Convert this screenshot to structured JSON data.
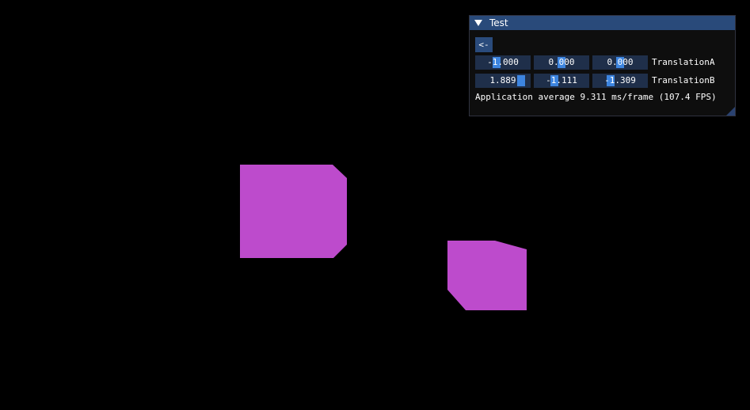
{
  "window": {
    "title": "Test",
    "collapse_icon": "triangle-down-icon",
    "back_label": "<-",
    "translation_a": {
      "label": "TranslationA",
      "values": [
        "-1.000",
        "0.000",
        "0.000"
      ]
    },
    "translation_b": {
      "label": "TranslationB",
      "values": [
        "1.889",
        "-1.111",
        "-1.309"
      ]
    },
    "status": "Application average 9.311 ms/frame (107.4 FPS)",
    "colors": {
      "title_bar": "#294a7a",
      "frame_bg": "#1f2f4a",
      "grab": "#3d85e0",
      "button": "#2a4b7c"
    }
  },
  "scene": {
    "background": "#000000",
    "shape_color": "#bd4bcc",
    "shapes": [
      "object-a",
      "object-b"
    ]
  }
}
